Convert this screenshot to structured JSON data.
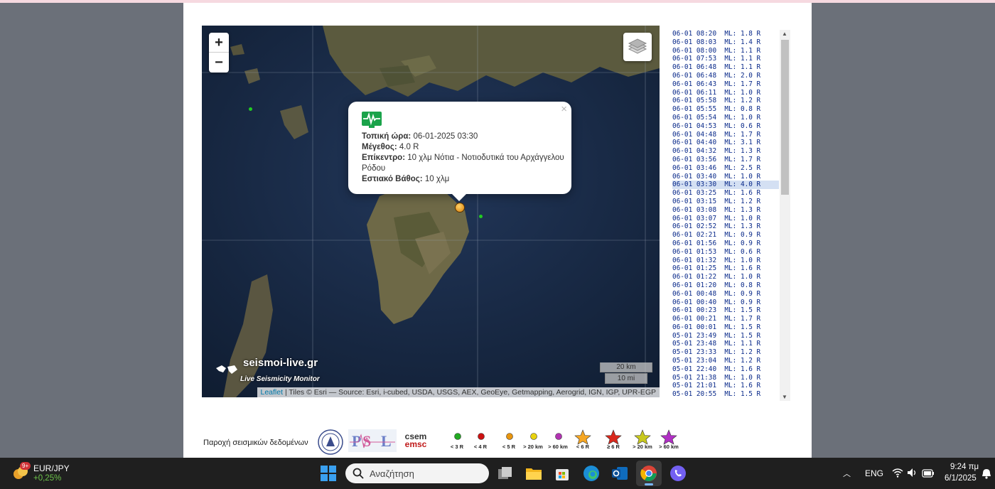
{
  "map": {
    "zoom_in": "+",
    "zoom_out": "−",
    "popup": {
      "close": "×",
      "local_time_label": "Τοπική ώρα:",
      "local_time_value": "06-01-2025 03:30",
      "magnitude_label": "Μέγεθος:",
      "magnitude_value": "4.0 R",
      "epicenter_label": "Επίκεντρο:",
      "epicenter_value": "10 χλμ Νότια - Νοτιοδυτικά του Αρχάγγελου Ρόδου",
      "depth_label": "Εστιακό Βάθος:",
      "depth_value": "10 χλμ"
    },
    "watermark_brand": "seismoi-live.gr",
    "watermark_sub": "Live Seismicity Monitor",
    "scale_km": "20 km",
    "scale_mi": "10 mi",
    "attribution_link": "Leaflet",
    "attribution_text": " | Tiles © Esri — Source: Esri, i-cubed, USDA, USGS, AEX, GeoEye, Getmapping, Aerogrid, IGN, IGP, UPR-EGP"
  },
  "events": [
    "06-01 08:20  ML: 1.8 R",
    "06-01 08:03  ML: 1.4 R",
    "06-01 08:00  ML: 1.1 R",
    "06-01 07:53  ML: 1.1 R",
    "06-01 06:48  ML: 1.1 R",
    "06-01 06:48  ML: 2.0 R",
    "06-01 06:43  ML: 1.7 R",
    "06-01 06:11  ML: 1.0 R",
    "06-01 05:58  ML: 1.2 R",
    "06-01 05:55  ML: 0.8 R",
    "06-01 05:54  ML: 1.0 R",
    "06-01 04:53  ML: 0.6 R",
    "06-01 04:48  ML: 1.7 R",
    "06-01 04:40  ML: 3.1 R",
    "06-01 04:32  ML: 1.3 R",
    "06-01 03:56  ML: 1.7 R",
    "06-01 03:46  ML: 2.5 R",
    "06-01 03:40  ML: 1.0 R",
    "06-01 03:30  ML: 4.0 R",
    "06-01 03:25  ML: 1.6 R",
    "06-01 03:15  ML: 1.2 R",
    "06-01 03:08  ML: 1.3 R",
    "06-01 03:07  ML: 1.0 R",
    "06-01 02:52  ML: 1.3 R",
    "06-01 02:21  ML: 0.9 R",
    "06-01 01:56  ML: 0.9 R",
    "06-01 01:53  ML: 0.6 R",
    "06-01 01:32  ML: 1.0 R",
    "06-01 01:25  ML: 1.6 R",
    "06-01 01:22  ML: 1.0 R",
    "06-01 01:20  ML: 0.8 R",
    "06-01 00:48  ML: 0.9 R",
    "06-01 00:40  ML: 0.9 R",
    "06-01 00:23  ML: 1.5 R",
    "06-01 00:21  ML: 1.7 R",
    "06-01 00:01  ML: 1.5 R",
    "05-01 23:49  ML: 1.5 R",
    "05-01 23:48  ML: 1.1 R",
    "05-01 23:33  ML: 1.2 R",
    "05-01 23:04  ML: 1.2 R",
    "05-01 22:40  ML: 1.6 R",
    "05-01 21:38  ML: 1.0 R",
    "05-01 21:01  ML: 1.6 R",
    "05-01 20:55  ML: 1.5 R"
  ],
  "selected_event_index": 18,
  "providers": {
    "label": "Παροχή σεισμικών δεδομένων",
    "logo3_text_top": "csem",
    "logo3_text_bottom": "emsc"
  },
  "legend": [
    {
      "label": "< 3 R",
      "color": "#22aa22",
      "shape": "dot"
    },
    {
      "label": "< 4 R",
      "color": "#cc1111",
      "shape": "dot"
    },
    {
      "label": "< 5 R",
      "color": "#e8950e",
      "shape": "dot"
    },
    {
      "label": "> 20 km",
      "color": "#e8d20e",
      "shape": "dot"
    },
    {
      "label": "> 60 km",
      "color": "#b233b2",
      "shape": "dot"
    },
    {
      "label": "< 6 R",
      "color": "#f5a623",
      "shape": "star"
    },
    {
      "label": "≥ 6 R",
      "color": "#d9281c",
      "shape": "star"
    },
    {
      "label": "> 20 km",
      "color": "#c8c81e",
      "shape": "star"
    },
    {
      "label": "> 60 km",
      "color": "#b02fc4",
      "shape": "star"
    }
  ],
  "taskbar": {
    "ticker_badge": "9+",
    "ticker_name": "EUR/JPY",
    "ticker_change": "+0,25%",
    "search_placeholder": "Αναζήτηση",
    "language": "ENG",
    "time": "9:24 πμ",
    "date": "6/1/2025"
  },
  "colors": {
    "event_text": "#0a2a8a",
    "selected_row": "#d4e0f3",
    "ticker_change": "#6cc24a"
  }
}
